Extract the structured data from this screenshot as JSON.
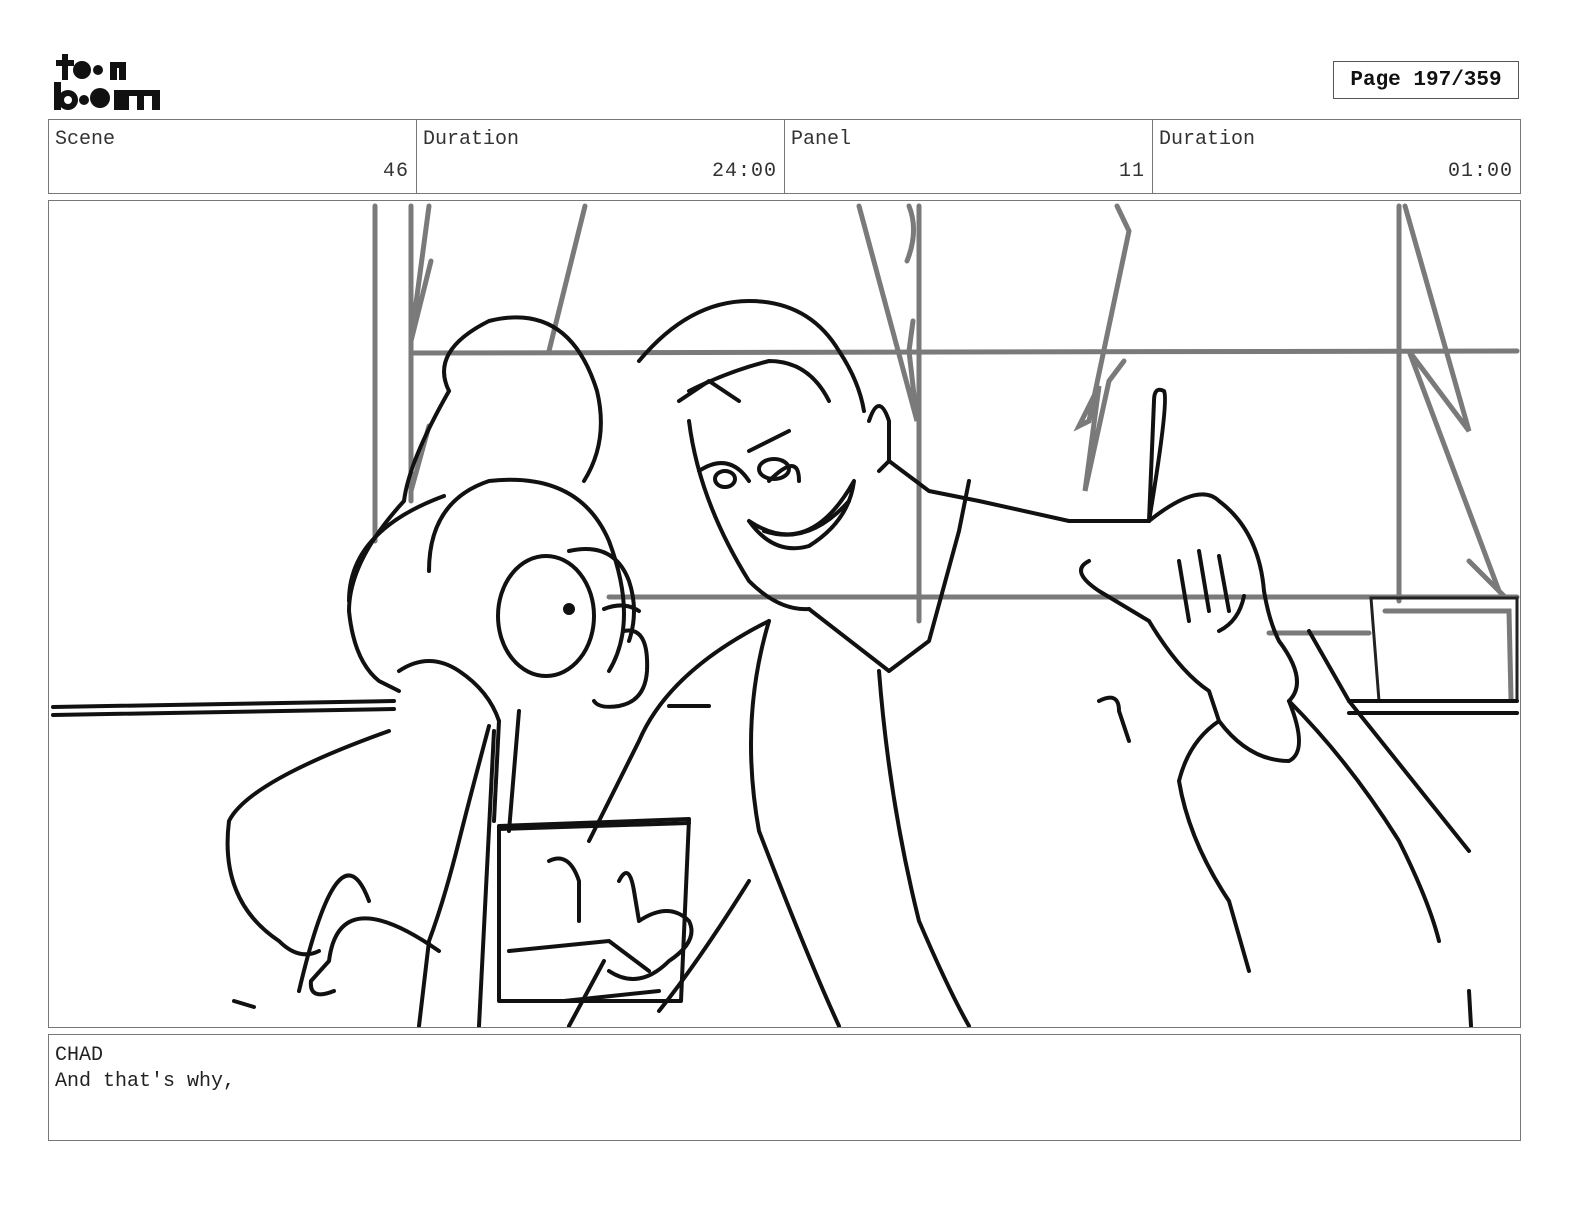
{
  "logo": {
    "line1": "toon",
    "line2": "boom",
    "icon": "toonboom-logo"
  },
  "page": {
    "label": "Page 197/359"
  },
  "header": {
    "scene_label": "Scene",
    "scene_value": "46",
    "duration1_label": "Duration",
    "duration1_value": "24:00",
    "panel_label": "Panel",
    "panel_value": "11",
    "duration2_label": "Duration",
    "duration2_value": "01:00"
  },
  "dialog": {
    "speaker": "CHAD",
    "line": "And that's why,"
  },
  "colors": {
    "border": "#777777",
    "sketch_line": "#111111",
    "background_line": "#7a7a7a"
  }
}
